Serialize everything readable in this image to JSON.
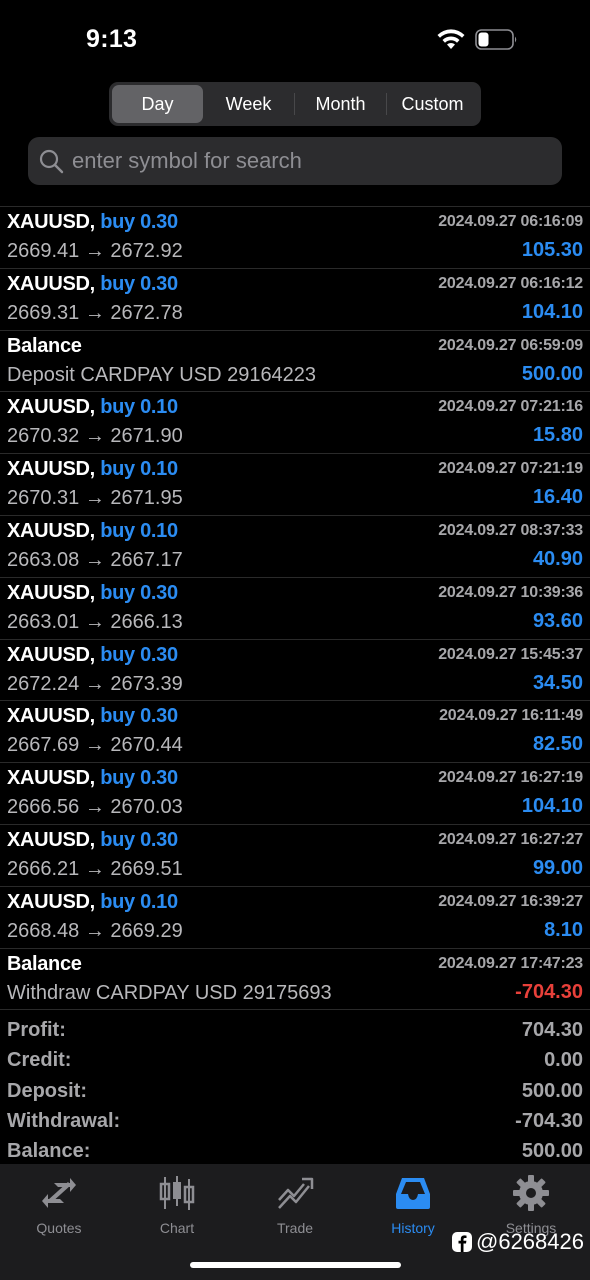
{
  "status_bar": {
    "time": "9:13"
  },
  "segments": [
    "Day",
    "Week",
    "Month",
    "Custom"
  ],
  "search": {
    "placeholder": "enter symbol for search"
  },
  "rows": [
    {
      "symbol": "XAUUSD,",
      "action": "buy 0.30",
      "time": "2024.09.27 06:16:09",
      "detail": "2669.41 → 2672.92",
      "profit": "105.30"
    },
    {
      "symbol": "XAUUSD,",
      "action": "buy 0.30",
      "time": "2024.09.27 06:16:12",
      "detail": "2669.31 → 2672.78",
      "profit": "104.10"
    },
    {
      "symbol": "Balance",
      "action": "",
      "time": "2024.09.27 06:59:09",
      "detail": "Deposit CARDPAY USD 29164223",
      "profit": "500.00"
    },
    {
      "symbol": "XAUUSD,",
      "action": "buy 0.10",
      "time": "2024.09.27 07:21:16",
      "detail": "2670.32 → 2671.90",
      "profit": "15.80"
    },
    {
      "symbol": "XAUUSD,",
      "action": "buy 0.10",
      "time": "2024.09.27 07:21:19",
      "detail": "2670.31 → 2671.95",
      "profit": "16.40"
    },
    {
      "symbol": "XAUUSD,",
      "action": "buy 0.10",
      "time": "2024.09.27 08:37:33",
      "detail": "2663.08 → 2667.17",
      "profit": "40.90"
    },
    {
      "symbol": "XAUUSD,",
      "action": "buy 0.30",
      "time": "2024.09.27 10:39:36",
      "detail": "2663.01 → 2666.13",
      "profit": "93.60"
    },
    {
      "symbol": "XAUUSD,",
      "action": "buy 0.30",
      "time": "2024.09.27 15:45:37",
      "detail": "2672.24 → 2673.39",
      "profit": "34.50"
    },
    {
      "symbol": "XAUUSD,",
      "action": "buy 0.30",
      "time": "2024.09.27 16:11:49",
      "detail": "2667.69 → 2670.44",
      "profit": "82.50"
    },
    {
      "symbol": "XAUUSD,",
      "action": "buy 0.30",
      "time": "2024.09.27 16:27:19",
      "detail": "2666.56 → 2670.03",
      "profit": "104.10"
    },
    {
      "symbol": "XAUUSD,",
      "action": "buy 0.30",
      "time": "2024.09.27 16:27:27",
      "detail": "2666.21 → 2669.51",
      "profit": "99.00"
    },
    {
      "symbol": "XAUUSD,",
      "action": "buy 0.10",
      "time": "2024.09.27 16:39:27",
      "detail": "2668.48 → 2669.29",
      "profit": "8.10"
    },
    {
      "symbol": "Balance",
      "action": "",
      "time": "2024.09.27 17:47:23",
      "detail": "Withdraw CARDPAY USD 29175693",
      "profit": "-704.30"
    }
  ],
  "summary": [
    {
      "label": "Profit:",
      "value": "704.30"
    },
    {
      "label": "Credit:",
      "value": "0.00"
    },
    {
      "label": "Deposit:",
      "value": "500.00"
    },
    {
      "label": "Withdrawal:",
      "value": "-704.30"
    },
    {
      "label": "Balance:",
      "value": "500.00"
    }
  ],
  "tabs": [
    {
      "label": "Quotes",
      "icon": "quotes-icon"
    },
    {
      "label": "Chart",
      "icon": "chart-icon"
    },
    {
      "label": "Trade",
      "icon": "trade-icon"
    },
    {
      "label": "History",
      "icon": "history-icon"
    },
    {
      "label": "Settings",
      "icon": "gear-icon"
    }
  ],
  "watermark": "@6268426",
  "colors": {
    "accent": "#2b8cf2",
    "negative": "#e8403a",
    "background": "#000000"
  }
}
